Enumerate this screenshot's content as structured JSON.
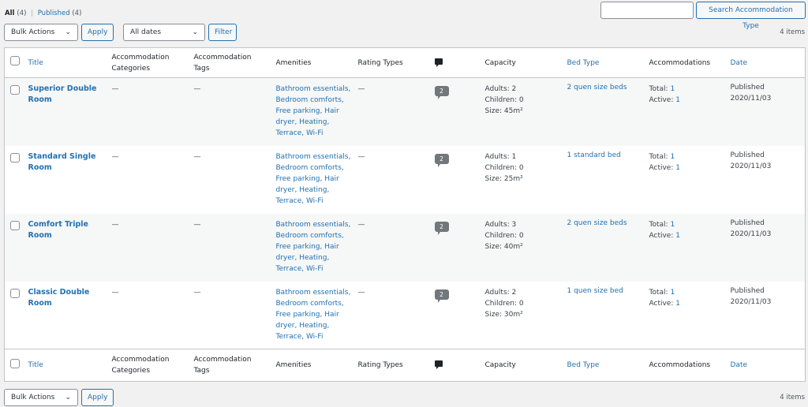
{
  "views": {
    "all_label": "All",
    "all_count": "(4)",
    "sep": "|",
    "published_label": "Published",
    "published_count": "(4)"
  },
  "search": {
    "value": "",
    "button": "Search Accommodation Type"
  },
  "top_nav": {
    "bulk": "Bulk Actions",
    "apply": "Apply",
    "dates": "All dates",
    "filter": "Filter",
    "count": "4 items"
  },
  "bottom_nav": {
    "bulk": "Bulk Actions",
    "apply": "Apply",
    "count": "4 items"
  },
  "columns": {
    "title": "Title",
    "cat1": "Accommodation",
    "cat2": "Categories",
    "tag1": "Accommodation",
    "tag2": "Tags",
    "amenities": "Amenities",
    "rating": "Rating Types",
    "comments_icon": "comment-icon",
    "capacity": "Capacity",
    "bed": "Bed Type",
    "accommodations": "Accommodations",
    "date": "Date"
  },
  "rows": [
    {
      "title": "Superior Double Room",
      "cat": "—",
      "tags": "—",
      "amenities": "Bathroom essentials, Bedroom comforts, Free parking, Hair dryer, Heating, Terrace, Wi-Fi",
      "rating": "—",
      "comments": "2",
      "adults": "Adults: 2",
      "children": "Children: 0",
      "size": "Size: 45m²",
      "bed": "2 quen size beds",
      "total_label": "Total:",
      "total": "1",
      "active_label": "Active:",
      "active": "1",
      "status": "Published",
      "date": "2020/11/03"
    },
    {
      "title": "Standard Single Room",
      "cat": "—",
      "tags": "—",
      "amenities": "Bathroom essentials, Bedroom comforts, Free parking, Hair dryer, Heating, Terrace, Wi-Fi",
      "rating": "—",
      "comments": "2",
      "adults": "Adults: 1",
      "children": "Children: 0",
      "size": "Size: 25m²",
      "bed": "1 standard bed",
      "total_label": "Total:",
      "total": "1",
      "active_label": "Active:",
      "active": "1",
      "status": "Published",
      "date": "2020/11/03"
    },
    {
      "title": "Comfort Triple Room",
      "cat": "—",
      "tags": "—",
      "amenities": "Bathroom essentials, Bedroom comforts, Free parking, Hair dryer, Heating, Terrace, Wi-Fi",
      "rating": "—",
      "comments": "2",
      "adults": "Adults: 3",
      "children": "Children: 0",
      "size": "Size: 40m²",
      "bed": "2 quen size beds",
      "total_label": "Total:",
      "total": "1",
      "active_label": "Active:",
      "active": "1",
      "status": "Published",
      "date": "2020/11/03"
    },
    {
      "title": "Classic Double Room",
      "cat": "—",
      "tags": "—",
      "amenities": "Bathroom essentials, Bedroom comforts, Free parking, Hair dryer, Heating, Terrace, Wi-Fi",
      "rating": "—",
      "comments": "2",
      "adults": "Adults: 2",
      "children": "Children: 0",
      "size": "Size: 30m²",
      "bed": "1 quen size bed",
      "total_label": "Total:",
      "total": "1",
      "active_label": "Active:",
      "active": "1",
      "status": "Published",
      "date": "2020/11/03"
    }
  ]
}
